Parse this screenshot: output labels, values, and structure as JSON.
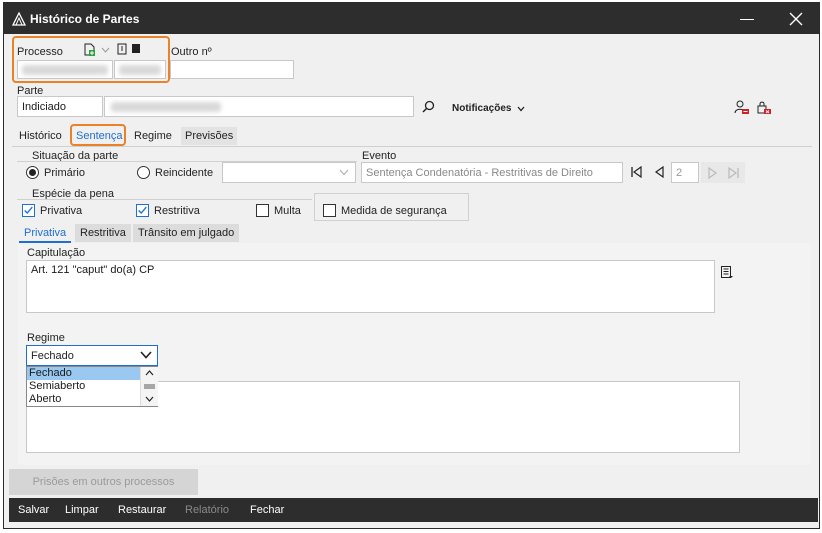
{
  "window": {
    "title": "Histórico de Partes",
    "minimize_label": "minimize",
    "close_label": "close"
  },
  "processo": {
    "label": "Processo",
    "outro_label": "Outro nº",
    "outro_value": ""
  },
  "parte": {
    "label": "Parte",
    "type_value": "Indiciado",
    "notificacoes_label": "Notificações"
  },
  "tabs": [
    {
      "label": "Histórico"
    },
    {
      "label": "Sentença"
    },
    {
      "label": "Regime"
    },
    {
      "label": "Previsões"
    }
  ],
  "sentenca": {
    "situacao_label": "Situação da parte",
    "primario_label": "Primário",
    "reincidente_label": "Reincidente",
    "evento_label": "Evento",
    "evento_value": "Sentença Condenatória - Restritivas de Direito",
    "nav_index": "2",
    "especie_label": "Espécie da pena",
    "privativa_label": "Privativa",
    "restritiva_label": "Restritiva",
    "multa_label": "Multa",
    "medida_label": "Medida de segurança"
  },
  "subtabs": [
    {
      "label": "Privativa"
    },
    {
      "label": "Restritiva"
    },
    {
      "label": "Trânsito em julgado"
    }
  ],
  "capitulacao": {
    "label": "Capitulação",
    "value": "Art. 121 \"caput\" do(a) CP"
  },
  "regime": {
    "label": "Regime",
    "selected": "Fechado",
    "options": [
      "Fechado",
      "Semiaberto",
      "Aberto"
    ]
  },
  "buttons": {
    "prisoes": "Prisões em outros processos"
  },
  "footer": {
    "salvar": "Salvar",
    "limpar": "Limpar",
    "restaurar": "Restaurar",
    "relatorio": "Relatório",
    "fechar": "Fechar"
  },
  "colors": {
    "titlebar": "#2d2d2d",
    "accent": "#1e6fd0",
    "highlight": "#e8832a",
    "selection": "#99c8f0"
  }
}
